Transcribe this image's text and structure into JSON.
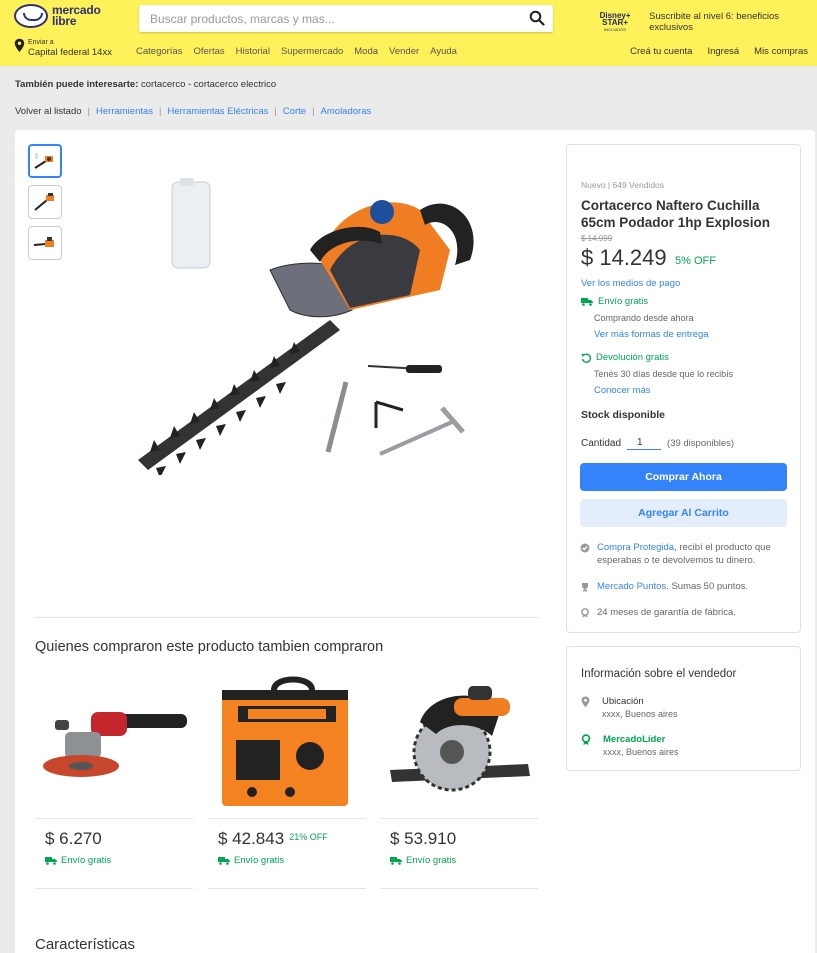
{
  "header": {
    "logo_line1": "mercado",
    "logo_line2": "libre",
    "search_placeholder": "Buscar productos, marcas y mas...",
    "promo_brand_line1": "Disney+ STAR+",
    "promo_brand_line2": "INCLUIDOS",
    "promo_text": "Suscribite al nivel 6: beneficios exclusivos",
    "ship_to_label": "Enviar a",
    "ship_to_value": "Capital federal 14xx",
    "nav": [
      "Categorías",
      "Ofertas",
      "Historial",
      "Supermercado",
      "Moda",
      "Vender",
      "Ayuda"
    ],
    "user_nav": [
      "Creá tu cuenta",
      "Ingresá",
      "Mis compras"
    ]
  },
  "interest": {
    "label": "También puede interesarte:",
    "value": "cortacerco - cortacerco electrico"
  },
  "breadcrumb": {
    "back": "Volver al listado",
    "items": [
      "Herramientas",
      "Herramientas Eléctricas",
      "Corte",
      "Amoladoras"
    ]
  },
  "product": {
    "condition": "Nuevo | 649 Vendidos",
    "title": "Cortacerco Naftero Cuchilla 65cm Podador 1hp Explosion",
    "old_price": "$ 14.999",
    "price": "$ 14.249",
    "discount": "5% OFF",
    "payment_link": "Ver los medios de pago",
    "shipping_title": "Envío gratis",
    "shipping_sub": "Comprando desde ahora",
    "shipping_link": "Ver más formas de entrega",
    "return_title": "Devolución gratis",
    "return_sub": "Tenés 30 días desde que lo recibís",
    "return_link": "Conocer más",
    "stock": "Stock disponible",
    "qty_label": "Cantidad",
    "qty_value": "1",
    "qty_available": "(39 disponibles)",
    "buy_label": "Comprar Ahora",
    "cart_label": "Agregar Al Carrito",
    "protect_link": "Compra Protegida",
    "protect_text": ", recibí el producto que esperabas o te devolvemos tu dinero.",
    "points_link": "Mercado Puntos",
    "points_text": ". Sumas 50 puntos.",
    "warranty": "24 meses de garantía de fábrica."
  },
  "seller": {
    "title": "Información sobre el vendedor",
    "location_label": "Ubicación",
    "location_value": "xxxx, Buenos aires",
    "level_label": "MercadoLíder",
    "level_value": "xxxx, Buenos aires"
  },
  "recommendations": {
    "title": "Quienes compraron este producto tambien compraron",
    "items": [
      {
        "price": "$ 6.270",
        "discount": "",
        "shipping": "Envío gratis",
        "icon": "angle-grinder-image"
      },
      {
        "price": "$ 42.843",
        "discount": "21% OFF",
        "shipping": "Envío gratis",
        "icon": "welder-image"
      },
      {
        "price": "$ 53.910",
        "discount": "",
        "shipping": "Envío gratis",
        "icon": "circular-saw-image"
      }
    ]
  },
  "features_title": "Características",
  "colors": {
    "header_yellow": "#fff159",
    "accent_blue": "#3483fa",
    "green": "#00a650",
    "orange": "#f07d22"
  }
}
